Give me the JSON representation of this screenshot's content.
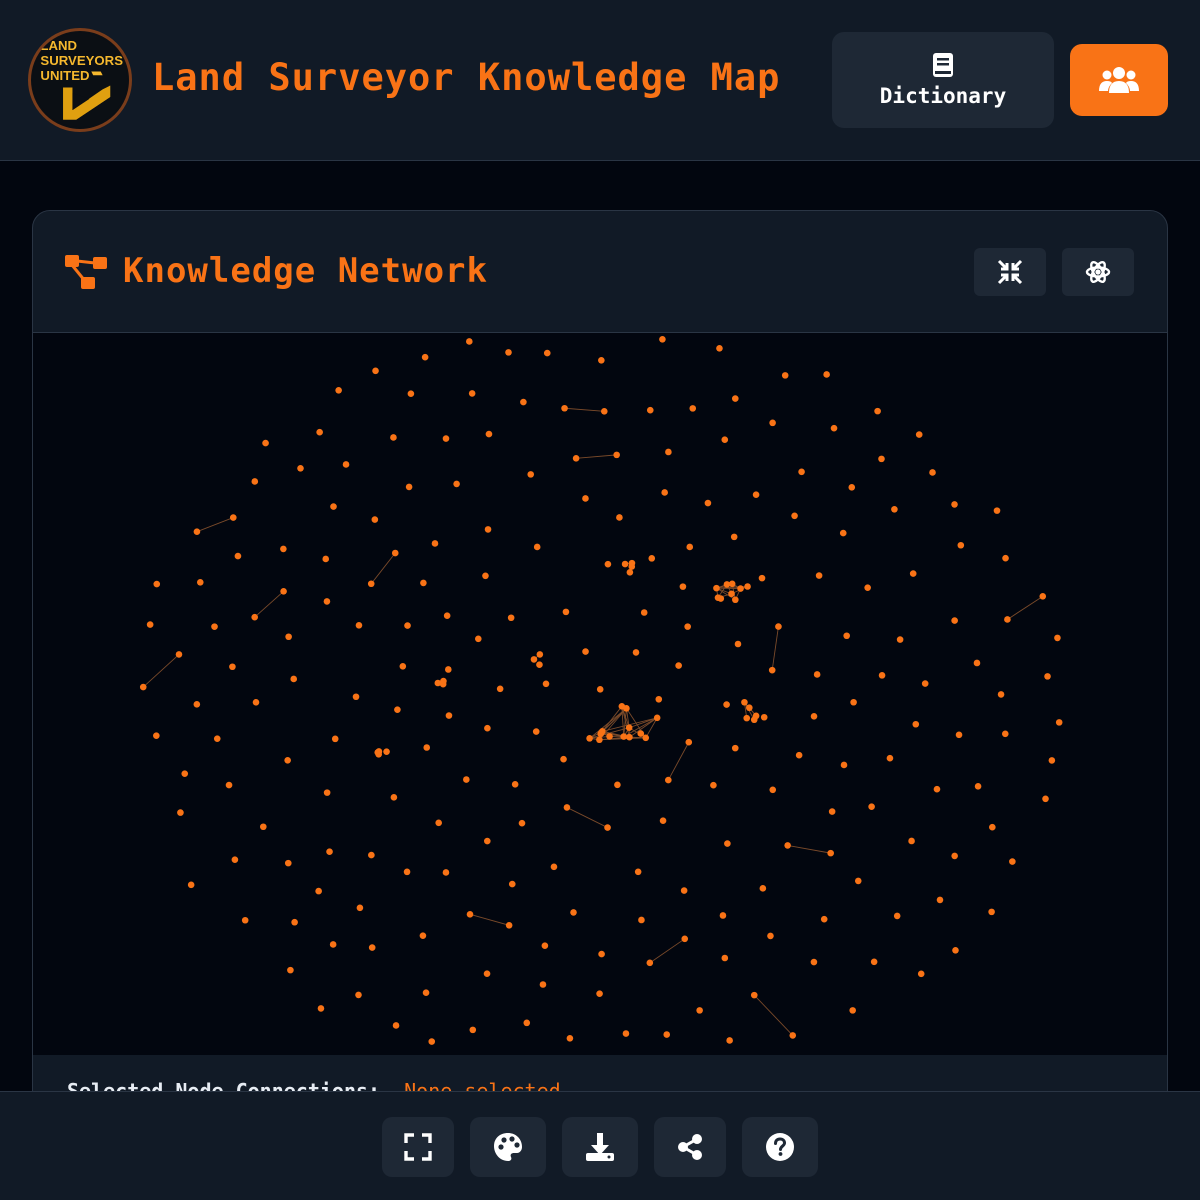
{
  "header": {
    "logo_text": [
      "LAND",
      "SURVEYORS",
      "UNITED"
    ],
    "title": "Land Surveyor Knowledge Map",
    "dictionary_label": "Dictionary",
    "dictionary_icon": "book-icon",
    "community_icon": "users-icon"
  },
  "panel": {
    "icon": "network-icon",
    "title": "Knowledge Network",
    "collapse_icon": "compress-icon",
    "settings_icon": "atom-icon",
    "selected_label": "Selected Node Connections:",
    "selected_value": "None selected"
  },
  "bottom_toolbar": [
    {
      "icon": "fullscreen-icon"
    },
    {
      "icon": "palette-icon"
    },
    {
      "icon": "download-icon"
    },
    {
      "icon": "share-icon"
    },
    {
      "icon": "help-icon"
    }
  ],
  "colors": {
    "accent": "#f97316",
    "background": "#02060f",
    "surface": "#111a26",
    "button": "#1e2835",
    "border": "#2a3544"
  }
}
